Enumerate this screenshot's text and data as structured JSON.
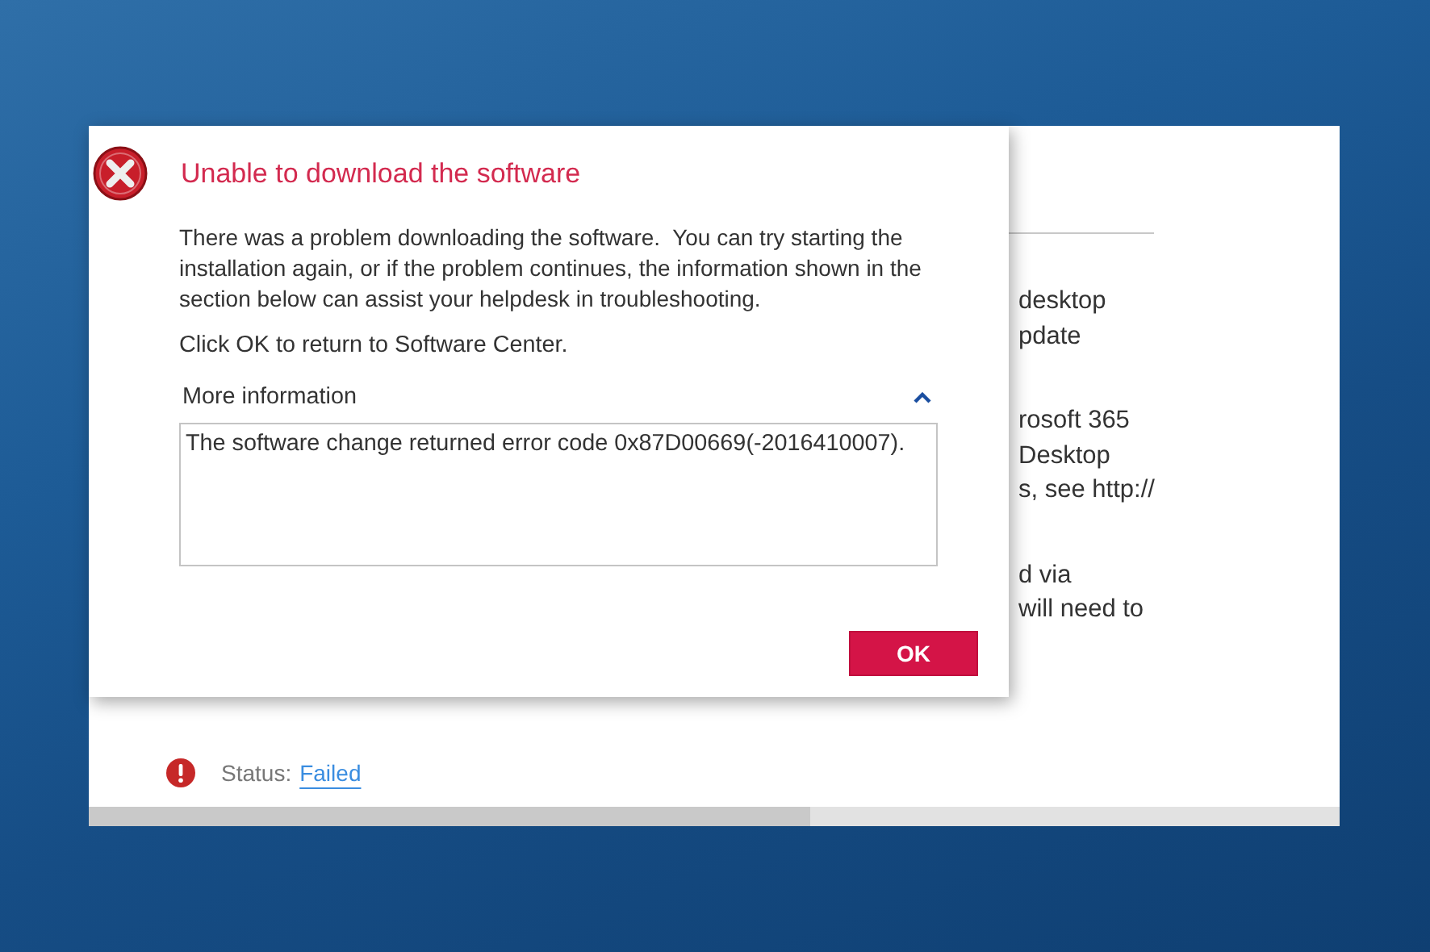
{
  "background_window": {
    "paragraphs": [
      [
        "desktop",
        "pdate"
      ],
      [
        "rosoft 365",
        "Desktop",
        "s, see http://"
      ],
      [
        "d via",
        "will need to"
      ]
    ],
    "status": {
      "label": "Status:",
      "value": "Failed"
    }
  },
  "dialog": {
    "title": "Unable to download the software",
    "message": "There was a problem downloading the software.  You can try starting the installation again, or if the problem continues, the information shown in the section below can assist your helpdesk in troubleshooting.",
    "hint": "Click OK to return to Software Center.",
    "more_info": {
      "label": "More information",
      "expanded": true,
      "details": "The software change returned error code 0x87D00669(-2016410007)."
    },
    "ok_button": "OK"
  }
}
